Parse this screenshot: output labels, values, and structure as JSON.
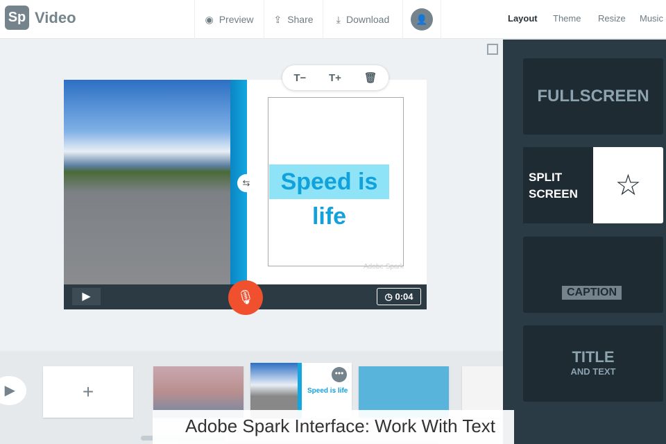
{
  "header": {
    "logo": "Sp",
    "app_name": "Video",
    "preview": "Preview",
    "share": "Share",
    "download": "Download",
    "right_tabs": [
      "Layout",
      "Theme",
      "Resize",
      "Music"
    ]
  },
  "toolbar": {
    "decrease": "T−",
    "increase": "T+"
  },
  "stage": {
    "text": "Speed is life",
    "watermark": "Adobe Spark",
    "duration": "0:04"
  },
  "layouts": {
    "fullscreen": "FULLSCREEN",
    "split1": "SPLIT",
    "split2": "SCREEN",
    "caption": "CAPTION",
    "title": "TITLE",
    "title_sub": "AND TEXT"
  },
  "timeline": {
    "add": "+",
    "thumb_text": "Speed is life"
  },
  "caption": "Adobe Spark Interface: Work With Text"
}
